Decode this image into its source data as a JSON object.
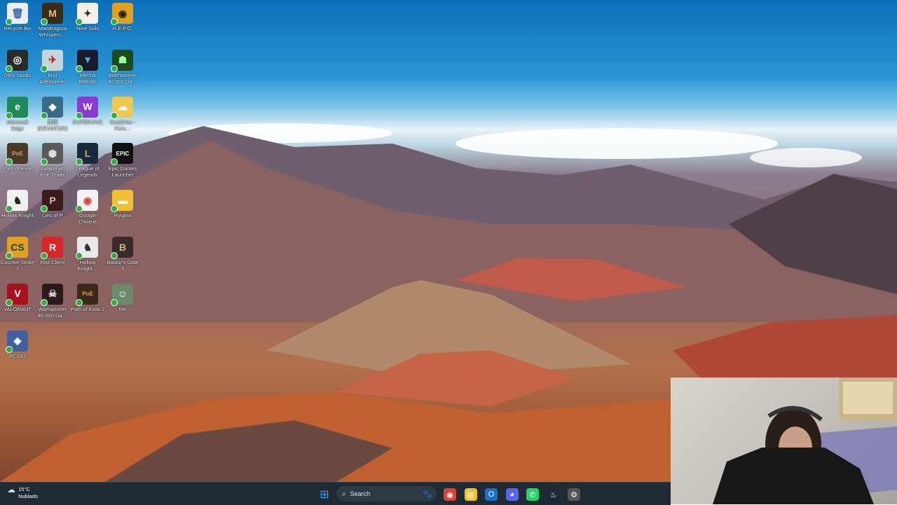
{
  "desktop": {
    "icons": [
      {
        "label": "Recycle Bin",
        "glyph": "🗑",
        "bg": "#e8eef4",
        "fg": "#3a6ea5"
      },
      {
        "label": "Mandragora Whispers…",
        "glyph": "M",
        "bg": "#3a2a18",
        "fg": "#e0c080"
      },
      {
        "label": "Nine Sols",
        "glyph": "✦",
        "bg": "#f4f0e4",
        "fg": "#333"
      },
      {
        "label": "R.E.P.O.",
        "glyph": "◉",
        "bg": "#e0a020",
        "fg": "#222"
      },
      {
        "label": "OBS Studio",
        "glyph": "◎",
        "bg": "#2a2a2a",
        "fg": "#fff"
      },
      {
        "label": "MSI Afterburner",
        "glyph": "✈",
        "bg": "#c8d4dc",
        "fg": "#c02020"
      },
      {
        "label": "Mecha BREAK",
        "glyph": "▼",
        "bg": "#1a1a2a",
        "fg": "#4ad"
      },
      {
        "label": "Warhammer 40,000 Da…",
        "glyph": "☗",
        "bg": "#1e4a1e",
        "fg": "#9f9"
      },
      {
        "label": "Microsoft Edge",
        "glyph": "e",
        "bg": "#1e8a5a",
        "fg": "#fff"
      },
      {
        "label": "異環 (DEVIATOR)",
        "glyph": "◆",
        "bg": "#3a6a8a",
        "fg": "#fff"
      },
      {
        "label": "SUPERVIVE",
        "glyph": "W",
        "bg": "#8a3ad0",
        "fg": "#fff"
      },
      {
        "label": "OneDrive - Pers…",
        "glyph": "☁",
        "bg": "#f0c850",
        "fg": "#fff"
      },
      {
        "label": "Path of Exile",
        "glyph": "PoE",
        "bg": "#4a3a2a",
        "fg": "#d0a060"
      },
      {
        "label": "Awakened PoE Trade",
        "glyph": "⬢",
        "bg": "#5a5a5a",
        "fg": "#ddd"
      },
      {
        "label": "League of Legends",
        "glyph": "L",
        "bg": "#1a2a3a",
        "fg": "#c8a860"
      },
      {
        "label": "Epic Games Launcher",
        "glyph": "EPIC",
        "bg": "#111",
        "fg": "#fff"
      },
      {
        "label": "Hollow Knight",
        "glyph": "♞",
        "bg": "#f0f0f0",
        "fg": "#222"
      },
      {
        "label": "Lies of P",
        "glyph": "P",
        "bg": "#3a1a1a",
        "fg": "#e0c0a0"
      },
      {
        "label": "Google Chrome",
        "glyph": "◉",
        "bg": "#f2f2f2",
        "fg": "#db4437"
      },
      {
        "label": "Ryujinx",
        "glyph": "▬",
        "bg": "#f0c030",
        "fg": "#fff"
      },
      {
        "label": "Counter-Strike 2",
        "glyph": "CS",
        "bg": "#e0a020",
        "fg": "#1a3a6a"
      },
      {
        "label": "Riot Client",
        "glyph": "R",
        "bg": "#d8262a",
        "fg": "#fff"
      },
      {
        "label": "Hollow Knight…",
        "glyph": "♞",
        "bg": "#e8e8e8",
        "fg": "#333"
      },
      {
        "label": "Baldur's Gate 3",
        "glyph": "B",
        "bg": "#3a2a2a",
        "fg": "#d0b080"
      },
      {
        "label": "VALORANT",
        "glyph": "V",
        "bg": "#a8121e",
        "fg": "#fff"
      },
      {
        "label": "Warhammer 40,000 Da…",
        "glyph": "☠",
        "bg": "#2a1a1a",
        "fg": "#ddd"
      },
      {
        "label": "Path of Exile 2",
        "glyph": "PoE",
        "bg": "#3a2a1a",
        "fg": "#e0a050"
      },
      {
        "label": "Me",
        "glyph": "☺",
        "bg": "#6a8a6a",
        "fg": "#fff"
      },
      {
        "label": "PCSX2",
        "glyph": "◈",
        "bg": "#4060a0",
        "fg": "#fff"
      }
    ]
  },
  "taskbar": {
    "weather_temp": "15°C",
    "weather_desc": "Nublado",
    "search_placeholder": "Search",
    "apps": [
      {
        "name": "start-button",
        "glyph": "⊞",
        "bg": "#2b7fd4"
      },
      {
        "name": "chrome",
        "glyph": "◉",
        "bg": "#db4437"
      },
      {
        "name": "file-explorer",
        "glyph": "▤",
        "bg": "#f0c030"
      },
      {
        "name": "outlook",
        "glyph": "O",
        "bg": "#1a6fc8"
      },
      {
        "name": "discord",
        "glyph": "◕",
        "bg": "#5865f2"
      },
      {
        "name": "whatsapp",
        "glyph": "✆",
        "bg": "#25d366"
      },
      {
        "name": "steam",
        "glyph": "♨",
        "bg": "#1b2838"
      },
      {
        "name": "app",
        "glyph": "⚙",
        "bg": "#555"
      }
    ]
  }
}
